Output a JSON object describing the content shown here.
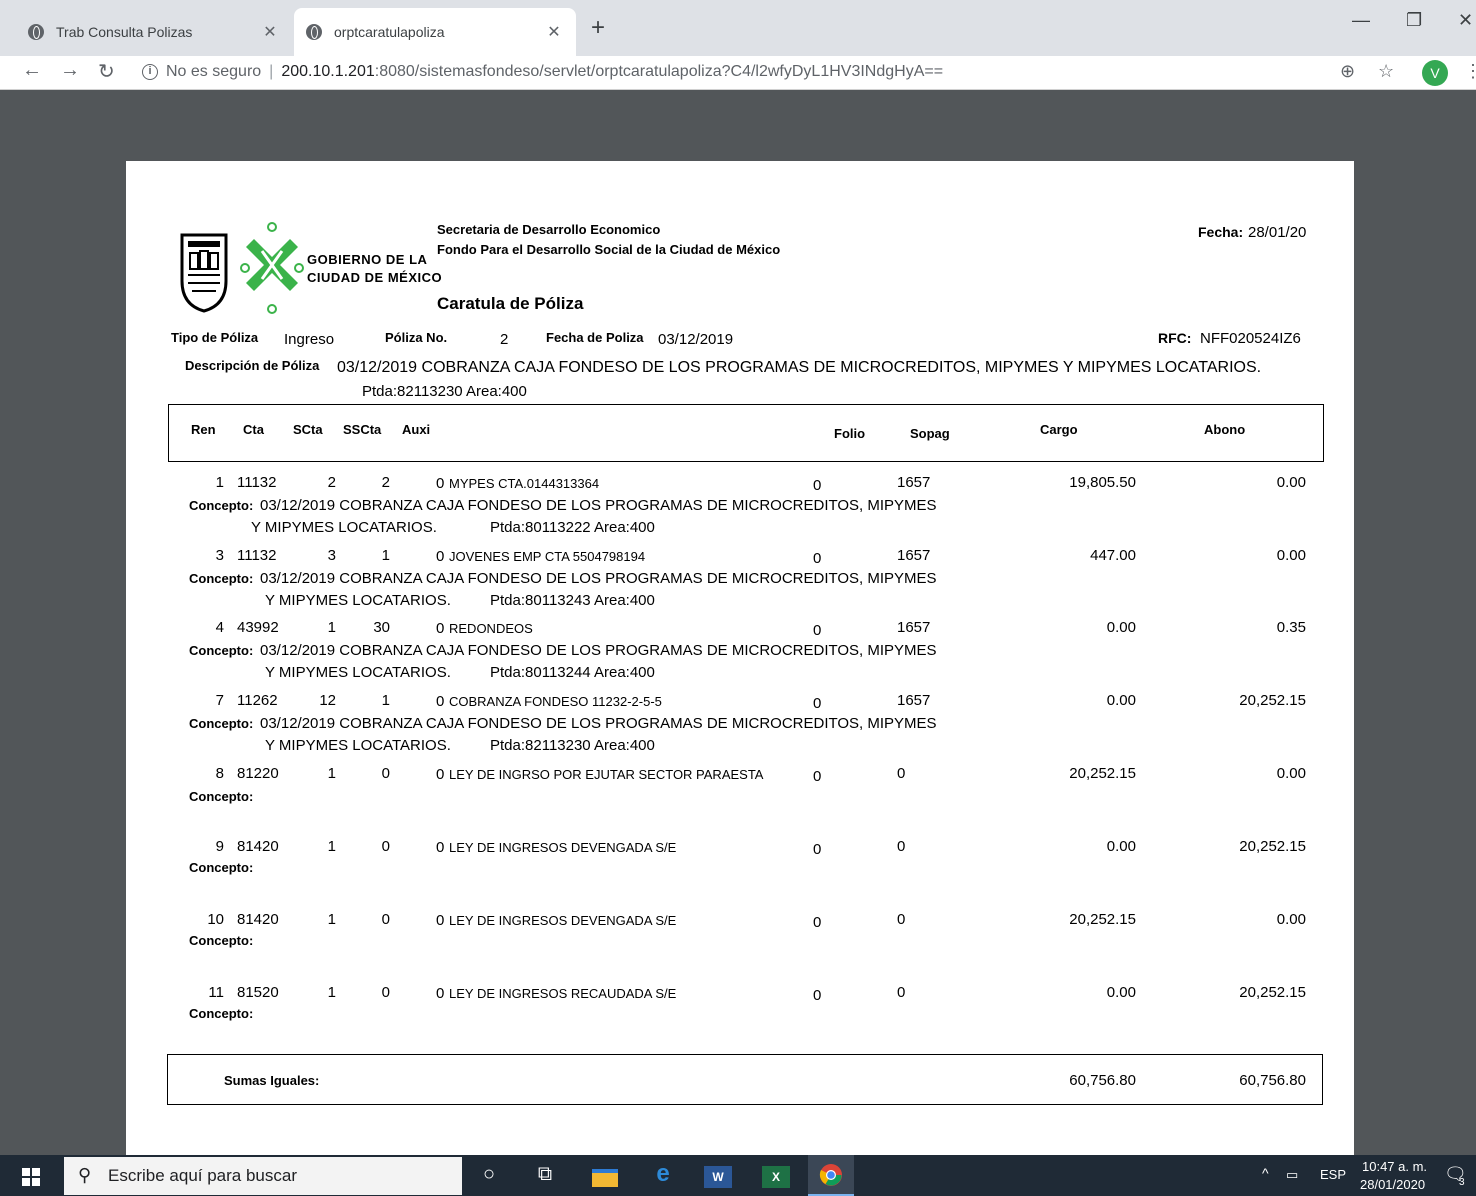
{
  "browser": {
    "tabs": [
      {
        "title": "Trab Consulta Polizas",
        "active": false
      },
      {
        "title": "orptcaratulapoliza",
        "active": true
      }
    ],
    "security_label": "No es seguro",
    "url_host": "200.10.1.201",
    "url_rest": ":8080/sistemasfondeso/servlet/orptcaratulapoliza?C4/l2wfyDyL1HV3INdgHyA==",
    "profile_initial": "V"
  },
  "report": {
    "logo_text_line1": "GOBIERNO DE LA",
    "logo_text_line2": "CIUDAD DE MÉXICO",
    "org_line1": "Secretaria de Desarrollo Economico",
    "org_line2": "Fondo Para el Desarrollo Social de la Ciudad de México",
    "title": "Caratula de Póliza",
    "fecha_label": "Fecha:",
    "fecha_value": "28/01/20",
    "tipo_label": "Tipo de Póliza",
    "tipo_value": "Ingreso",
    "poliza_no_label": "Póliza No.",
    "poliza_no_value": "2",
    "fecha_poliza_label": "Fecha de Poliza",
    "fecha_poliza_value": "03/12/2019",
    "rfc_label": "RFC:",
    "rfc_value": "NFF020524IZ6",
    "descripcion_label": "Descripción de Póliza",
    "descripcion_line1": "03/12/2019 COBRANZA CAJA FONDESO DE LOS PROGRAMAS DE MICROCREDITOS, MIPYMES Y MIPYMES LOCATARIOS.",
    "descripcion_line2": "Ptda:82113230 Area:400",
    "columns": {
      "ren": "Ren",
      "cta": "Cta",
      "scta": "SCta",
      "sscta": "SSCta",
      "auxi": "Auxi",
      "folio": "Folio",
      "sopag": "Sopag",
      "cargo": "Cargo",
      "abono": "Abono"
    },
    "concepto_label": "Concepto:",
    "rows": [
      {
        "ren": "1",
        "cta": "11132",
        "scta": "2",
        "sscta": "2",
        "auxi": "0",
        "desc": "MYPES CTA.0144313364",
        "folio": "0",
        "sopag": "1657",
        "cargo": "19,805.50",
        "abono": "0.00",
        "concepto1": "03/12/2019 COBRANZA CAJA FONDESO DE LOS PROGRAMAS DE MICROCREDITOS, MIPYMES",
        "concepto2": "Y MIPYMES LOCATARIOS.",
        "ptda": "Ptda:80113222 Area:400"
      },
      {
        "ren": "3",
        "cta": "11132",
        "scta": "3",
        "sscta": "1",
        "auxi": "0",
        "desc": "JOVENES EMP CTA 5504798194",
        "folio": "0",
        "sopag": "1657",
        "cargo": "447.00",
        "abono": "0.00",
        "concepto1": "03/12/2019 COBRANZA CAJA FONDESO DE LOS PROGRAMAS DE MICROCREDITOS, MIPYMES",
        "concepto2": "Y MIPYMES LOCATARIOS.",
        "ptda": "Ptda:80113243 Area:400"
      },
      {
        "ren": "4",
        "cta": "43992",
        "scta": "1",
        "sscta": "30",
        "auxi": "0",
        "desc": "REDONDEOS",
        "folio": "0",
        "sopag": "1657",
        "cargo": "0.00",
        "abono": "0.35",
        "concepto1": "03/12/2019 COBRANZA CAJA FONDESO DE LOS PROGRAMAS DE MICROCREDITOS, MIPYMES",
        "concepto2": "Y MIPYMES LOCATARIOS.",
        "ptda": "Ptda:80113244 Area:400"
      },
      {
        "ren": "7",
        "cta": "11262",
        "scta": "12",
        "sscta": "1",
        "auxi": "0",
        "desc": "COBRANZA FONDESO 11232-2-5-5",
        "folio": "0",
        "sopag": "1657",
        "cargo": "0.00",
        "abono": "20,252.15",
        "concepto1": "03/12/2019 COBRANZA CAJA FONDESO DE LOS PROGRAMAS DE MICROCREDITOS, MIPYMES",
        "concepto2": "Y MIPYMES LOCATARIOS.",
        "ptda": "Ptda:82113230 Area:400"
      },
      {
        "ren": "8",
        "cta": "81220",
        "scta": "1",
        "sscta": "0",
        "auxi": "0",
        "desc": "LEY DE INGRSO POR EJUTAR SECTOR PARAESTA",
        "folio": "0",
        "sopag": "0",
        "cargo": "20,252.15",
        "abono": "0.00",
        "concepto1": "",
        "concepto2": "",
        "ptda": ""
      },
      {
        "ren": "9",
        "cta": "81420",
        "scta": "1",
        "sscta": "0",
        "auxi": "0",
        "desc": "LEY DE INGRESOS DEVENGADA S/E",
        "folio": "0",
        "sopag": "0",
        "cargo": "0.00",
        "abono": "20,252.15",
        "concepto1": "",
        "concepto2": "",
        "ptda": ""
      },
      {
        "ren": "10",
        "cta": "81420",
        "scta": "1",
        "sscta": "0",
        "auxi": "0",
        "desc": "LEY DE INGRESOS DEVENGADA S/E",
        "folio": "0",
        "sopag": "0",
        "cargo": "20,252.15",
        "abono": "0.00",
        "concepto1": "",
        "concepto2": "",
        "ptda": ""
      },
      {
        "ren": "11",
        "cta": "81520",
        "scta": "1",
        "sscta": "0",
        "auxi": "0",
        "desc": "LEY DE INGRESOS RECAUDADA S/E",
        "folio": "0",
        "sopag": "0",
        "cargo": "0.00",
        "abono": "20,252.15",
        "concepto1": "",
        "concepto2": "",
        "ptda": ""
      }
    ],
    "sumas_label": "Sumas Iguales:",
    "sumas_cargo": "60,756.80",
    "sumas_abono": "60,756.80"
  },
  "taskbar": {
    "search_placeholder": "Escribe aquí para buscar",
    "language": "ESP",
    "time": "10:47 a. m.",
    "date": "28/01/2020",
    "notification_count": "3"
  },
  "colors": {
    "viewer_bg": "#525659",
    "logo_green": "#3bb34a",
    "taskbar_bg": "#1f2a36",
    "profile_green": "#34a853"
  }
}
